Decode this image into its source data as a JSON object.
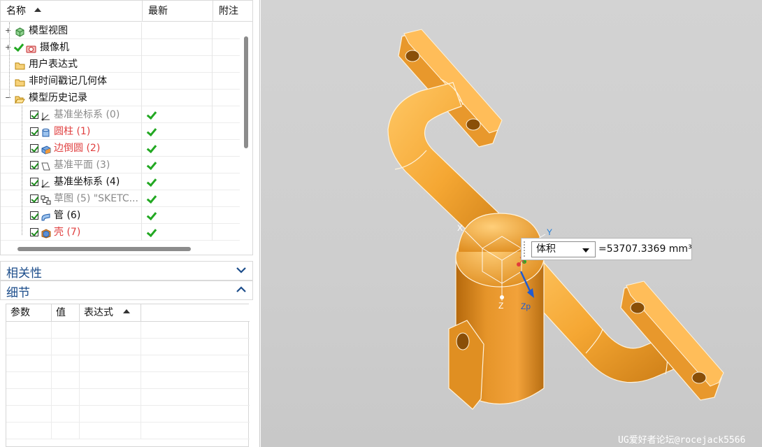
{
  "navigator": {
    "columns": {
      "name": "名称",
      "latest": "最新",
      "note": "附注"
    },
    "rows": [
      {
        "label": "模型视图",
        "icon": "model-views-icon",
        "expander": "+",
        "style": "black"
      },
      {
        "label": "摄像机",
        "icon": "camera-icon",
        "expander": "+",
        "style": "black"
      },
      {
        "label": "用户表达式",
        "icon": "folder-icon",
        "expander": "",
        "style": "black"
      },
      {
        "label": "非时间戳记几何体",
        "icon": "folder-icon",
        "expander": "",
        "style": "black"
      },
      {
        "label": "模型历史记录",
        "icon": "folder-open-icon",
        "expander": "−",
        "style": "black"
      },
      {
        "label": "基准坐标系 (0)",
        "icon": "datum-csys-icon",
        "style": "gray",
        "latest": true
      },
      {
        "label": "圆柱 (1)",
        "icon": "cylinder-icon",
        "style": "red",
        "latest": true
      },
      {
        "label": "边倒圆 (2)",
        "icon": "edge-blend-icon",
        "style": "red",
        "latest": true
      },
      {
        "label": "基准平面 (3)",
        "icon": "datum-plane-icon",
        "style": "gray",
        "latest": true
      },
      {
        "label": "基准坐标系 (4)",
        "icon": "datum-csys-icon",
        "style": "black",
        "latest": true
      },
      {
        "label": "草图 (5) \"SKETC...",
        "icon": "sketch-icon",
        "style": "gray",
        "latest": true
      },
      {
        "label": "管 (6)",
        "icon": "tube-icon",
        "style": "black",
        "latest": true
      },
      {
        "label": "壳 (7)",
        "icon": "shell-icon",
        "style": "red",
        "latest": true
      }
    ]
  },
  "panels": {
    "dependencies": "相关性",
    "details": "细节"
  },
  "details_table": {
    "columns": {
      "param": "参数",
      "value": "值",
      "expression": "表达式"
    }
  },
  "measure": {
    "type": "体积",
    "value": "=53707.3369 mm³"
  },
  "axes": {
    "x": "X",
    "y": "Y",
    "z": "Z",
    "zp": "Zp"
  },
  "colors": {
    "model": "#f5a733",
    "accent": "#1b4c8a",
    "check": "#22a822",
    "error": "#e04040"
  },
  "watermark": "UG爱好者论坛@rocejack5566"
}
